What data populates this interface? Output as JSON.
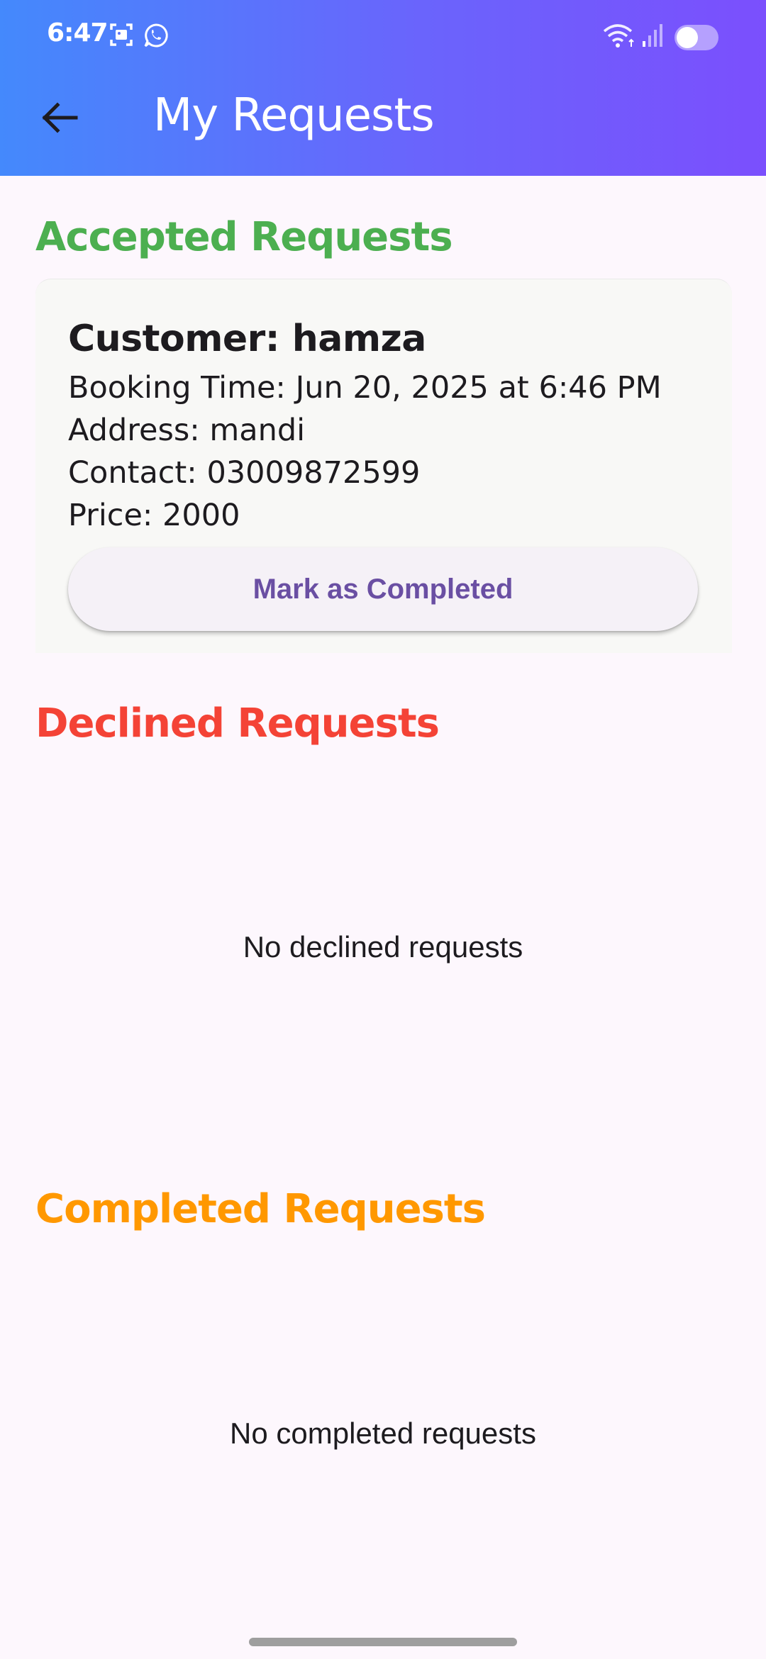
{
  "status_bar": {
    "time": "6:47",
    "icons": [
      "screenshot-icon",
      "whatsapp-icon",
      "wifi-icon",
      "signal-icon",
      "toggle-icon"
    ]
  },
  "header": {
    "title": "My Requests",
    "back_icon": "arrow-back-icon"
  },
  "colors": {
    "accepted": "#4caf50",
    "declined": "#f44336",
    "completed": "#ff9800",
    "button_text": "#6a4fa3"
  },
  "accepted": {
    "title": "Accepted Requests",
    "request": {
      "customer": "Customer: hamza",
      "booking_time": "Booking Time: Jun 20, 2025 at 6:46 PM",
      "address": "Address: mandi",
      "contact": "Contact: 03009872599",
      "price": "Price: 2000",
      "action_label": "Mark as Completed"
    }
  },
  "declined": {
    "title": "Declined Requests",
    "empty_text": "No declined requests"
  },
  "completed": {
    "title": "Completed Requests",
    "empty_text": "No completed requests"
  }
}
